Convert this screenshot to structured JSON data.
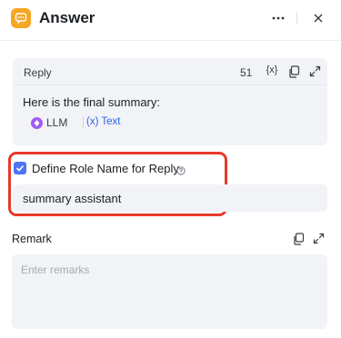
{
  "header": {
    "title": "Answer",
    "app_icon": "chat-bubble-icon",
    "more_icon": "more-horizontal-icon",
    "close_icon": "close-icon",
    "brand_color": "#f5a623"
  },
  "reply": {
    "label": "Reply",
    "char_count": "51",
    "variable_button": "{x}",
    "content_text": "Here is the final summary:",
    "tag_source": "LLM",
    "tag_variable": "(x) Text"
  },
  "role": {
    "checkbox_checked": true,
    "checkbox_label": "Define Role Name for Reply",
    "help_icon": "question-circle-icon",
    "input_value": "summary assistant",
    "highlight_color": "#e63a2b"
  },
  "remark": {
    "label": "Remark",
    "placeholder": "Enter remarks"
  }
}
